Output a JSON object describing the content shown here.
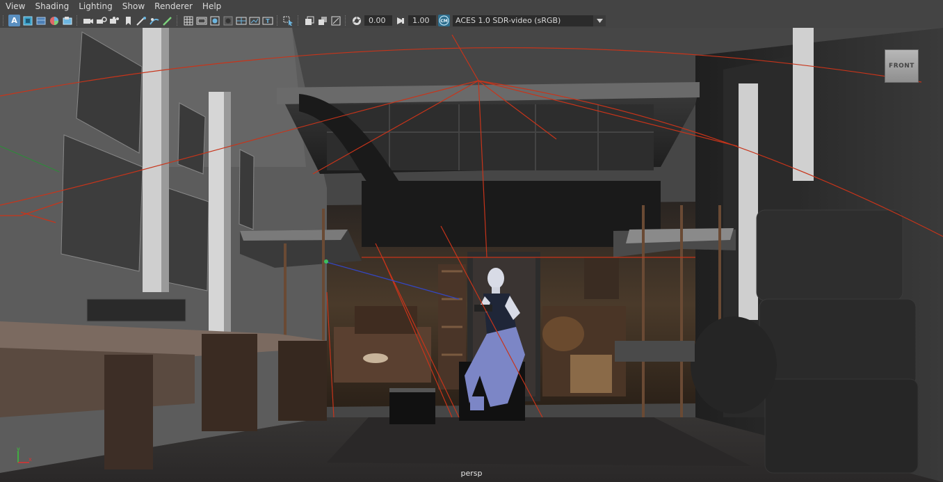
{
  "menu": {
    "items": [
      "View",
      "Shading",
      "Lighting",
      "Show",
      "Renderer",
      "Help"
    ]
  },
  "toolbar": {
    "exposure_value": "0.00",
    "gamma_value": "1.00",
    "color_management_label": "CM",
    "view_transform": "ACES 1.0 SDR-video (sRGB)",
    "select_camera_letter": "A",
    "text_tool_letter": "T"
  },
  "viewport": {
    "camera_name": "persp",
    "view_cube_face": "FRONT",
    "axis_y": "y",
    "axis_x": "x",
    "background_color": "#464646"
  },
  "colors": {
    "accent": "#5a8fc0",
    "light_wireframe": "#c8341a",
    "ui_background": "#444444"
  }
}
